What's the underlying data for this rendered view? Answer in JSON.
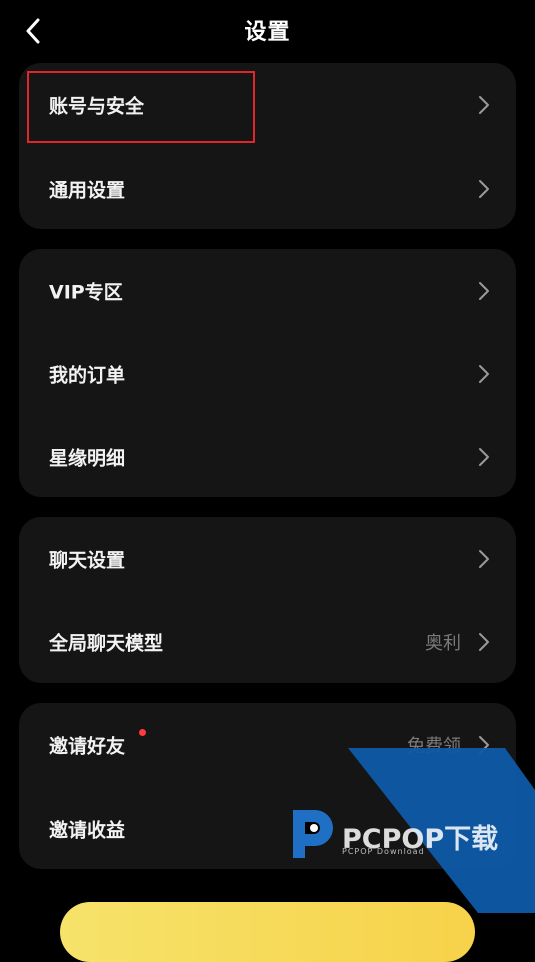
{
  "header": {
    "title": "设置"
  },
  "groups": [
    {
      "items": [
        {
          "label": "账号与安全"
        },
        {
          "label": "通用设置"
        }
      ]
    },
    {
      "items": [
        {
          "label": "VIP专区"
        },
        {
          "label": "我的订单"
        },
        {
          "label": "星缘明细"
        }
      ]
    },
    {
      "items": [
        {
          "label": "聊天设置"
        },
        {
          "label": "全局聊天模型",
          "value": "奥利"
        }
      ]
    },
    {
      "items": [
        {
          "label": "邀请好友",
          "value": "免费领",
          "badge": "red-dot"
        },
        {
          "label": "邀请收益"
        }
      ]
    }
  ],
  "watermark": {
    "text": "PCPOP下载",
    "sub": "PCPOP Download"
  },
  "colors": {
    "background": "#000000",
    "card": "#151515",
    "highlight": "#e0262d",
    "badge": "#ff3b3b",
    "watermark_blue": "#0f5aa8"
  }
}
